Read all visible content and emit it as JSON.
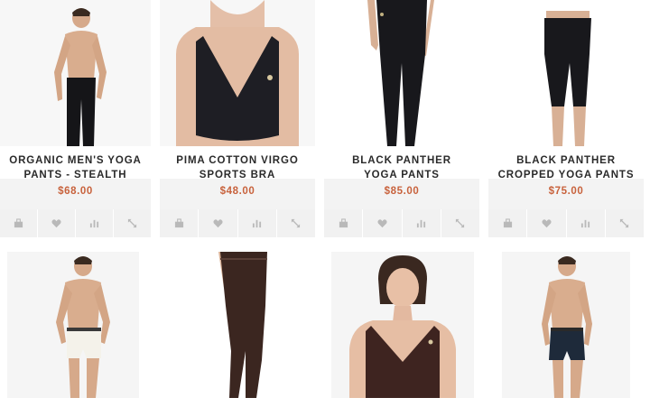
{
  "products": [
    {
      "title": "Organic Men's Yoga Pants - Stealth Black",
      "price": "$68.00"
    },
    {
      "title": "Pima Cotton Virgo Sports Bra",
      "price": "$48.00"
    },
    {
      "title": "Black Panther Yoga Pants",
      "price": "$85.00"
    },
    {
      "title": "Black Panther Cropped Yoga Pants",
      "price": "$75.00"
    }
  ],
  "actions": [
    "cart-icon",
    "heart-icon",
    "bar-chart-icon",
    "expand-icon"
  ],
  "colors": {
    "price": "#c8623c",
    "action_bg": "#f1f1f1",
    "price_bg": "#f3f3f3",
    "icon": "#b9b9b9"
  }
}
